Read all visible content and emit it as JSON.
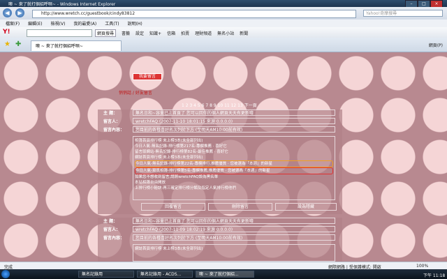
{
  "window": {
    "title": "噢 ~ 來了就打個招呼唄~ - Windows Internet Explorer"
  },
  "address_bar": {
    "url": "http://www.wretch.cc/guestbook/cindy83812",
    "search_placeholder": "Yahoo!奇摩搜尋"
  },
  "menu": [
    "檔案(F)",
    "編輯(E)",
    "檢視(V)",
    "我的最愛(A)",
    "工具(T)",
    "說明(H)"
  ],
  "yahoo_toolbar": {
    "logo": "Y!",
    "search_btn": "網頁搜尋",
    "items": [
      "書籤",
      "設定",
      "知識+",
      "信箱",
      "拍賣",
      "理財頻道",
      "無名小站",
      "新聞"
    ]
  },
  "tab": {
    "label": "噢 ~ 來了就打個招呼唄~",
    "right_tools": "網頁(P)"
  },
  "page": {
    "top_text": "我要留言",
    "mid_text": "悄悄話 / 好友留言",
    "pagination": "1 2 3 4 5 6 7 8 9 10 11 12 13 下一頁",
    "entry1": {
      "subject_label": "主 題：",
      "subject": "無名日和~容量已上首頁了 您可以回你的個人網頁天天有更新唷",
      "poster_label": "留言人：",
      "poster": "wretchFAQ",
      "date": "(2007-11-10 18:01:15 來源 0.0.0.0)",
      "content_label": "留言內容：",
      "content_lines": [
        "您目前的各種喜好名次列於下方 (至明天AM10:00前有效)",
        "相簿首頁排行榜 未上榜3本(未全部列出)",
        "今日人氣-無名記錄-排行榜第217名-專欄推薦 · 喜好它",
        "留言版網站-無名記錄-排行榜第82名-最佳推薦 · 喜好它",
        "網誌首頁排行榜 未上榜3本(未全部列出)",
        "今日人氣-無名記錄-排行榜第22名-專欄排行,推薦優質 · 您被選為「本週」的新星",
        "今日人氣-寫真相簿-排行榜第5名-專欄推薦,推薦優質 · 您被選為「本週」的新星",
        "如果您不想收到留言,請將wretchFAQ設為黑名單",
        "本站相簿自由開放",
        "上排行榜小秘訣:再三確定排行榜分類及指定人氣排行榜他們"
      ],
      "buttons": [
        "回覆留言",
        "刪除留言",
        "設為隱藏"
      ]
    },
    "entry2": {
      "subject_label": "主 題：",
      "subject": "無名日和~容量已上首頁了 您可以回你的個人網頁天天有更新唷",
      "poster_label": "留言人：",
      "poster": "wretchFAQ",
      "date": "(2007-11-09 18:02:19 來源 0.0.0.0)",
      "content_label": "留言內容：",
      "content_lines": [
        "您目前的各種喜好名次列於下方 (至明天AM10:00前有效)",
        "網誌首頁排行榜 未上榜3本(未全部列出)"
      ]
    }
  },
  "status_bar": {
    "left": "完成",
    "right": "網際網路 | 受保護模式: 開啟",
    "zoom": "100%"
  },
  "taskbar": {
    "items": [
      "無名記錄用",
      "無名記錄用 - ACDS...",
      "噢 ~ 來了就打個招..."
    ],
    "clock": "下午 11:18"
  }
}
